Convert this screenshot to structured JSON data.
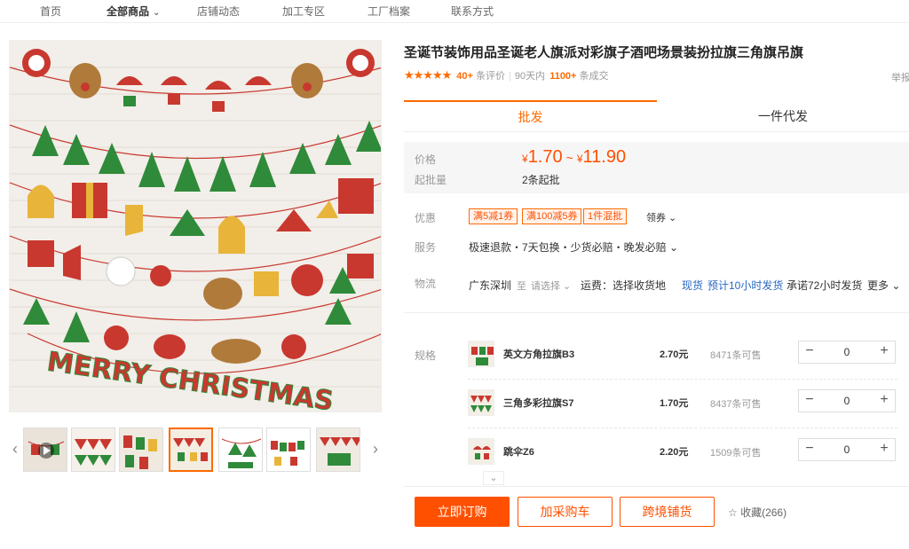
{
  "nav": {
    "items": [
      "首页",
      "全部商品",
      "店铺动态",
      "加工专区",
      "工厂档案",
      "联系方式"
    ]
  },
  "product": {
    "title": "圣诞节装饰用品圣诞老人旗派对彩旗子酒吧场景装扮拉旗三角旗吊旗",
    "rating_stars": 4.5,
    "rating_stars_text": "★★★★★",
    "review_count": "40+",
    "review_suffix": "条评价",
    "sales_prefix": "90天内",
    "sales_count": "1100+",
    "sales_suffix": "条成交",
    "report": "举报"
  },
  "tabs": [
    "批发",
    "一件代发"
  ],
  "price": {
    "label": "价格",
    "currency": "¥",
    "low": "1.70",
    "tilde": "~",
    "high": "11.90",
    "moq_label": "起批量",
    "moq": "2条起批"
  },
  "promo": {
    "label": "优惠",
    "coupons": [
      "满5减1券",
      "满100减5券",
      "1件混批"
    ],
    "get_coupon": "领券 ⌄"
  },
  "service": {
    "label": "服务",
    "text": "极速退款・7天包换・少货必赔・晚发必赔 ⌄"
  },
  "logistics": {
    "label": "物流",
    "from": "广东深圳",
    "to": "至",
    "choose": "请选择 ⌄",
    "fee": "运费：选择收货地",
    "stock": "现货",
    "ship_est": "预计10小时发货",
    "promise": "承诺72小时发货",
    "more": "更多 ⌄"
  },
  "specs": {
    "label": "规格",
    "rows": [
      {
        "name": "英文方角拉旗B3",
        "price": "2.70元",
        "stock": "8471条可售",
        "qty": "0"
      },
      {
        "name": "三角多彩拉旗S7",
        "price": "1.70元",
        "stock": "8437条可售",
        "qty": "0"
      },
      {
        "name": "跳伞Z6",
        "price": "2.20元",
        "stock": "1509条可售",
        "qty": "0"
      }
    ],
    "minus": "−",
    "plus": "+",
    "expand": "⌄"
  },
  "actions": {
    "buy_now": "立即订购",
    "add_cart": "加采购车",
    "cross_border": "跨境铺货",
    "favorite": "☆ 收藏(266)"
  },
  "image": {
    "banner_text": "MERRY CHRISTMAS",
    "thumb_prev": "‹",
    "thumb_next": "›"
  },
  "colors": {
    "accent": "#ff5000",
    "accent_light": "#ff6a00",
    "link": "#2a67c4"
  }
}
